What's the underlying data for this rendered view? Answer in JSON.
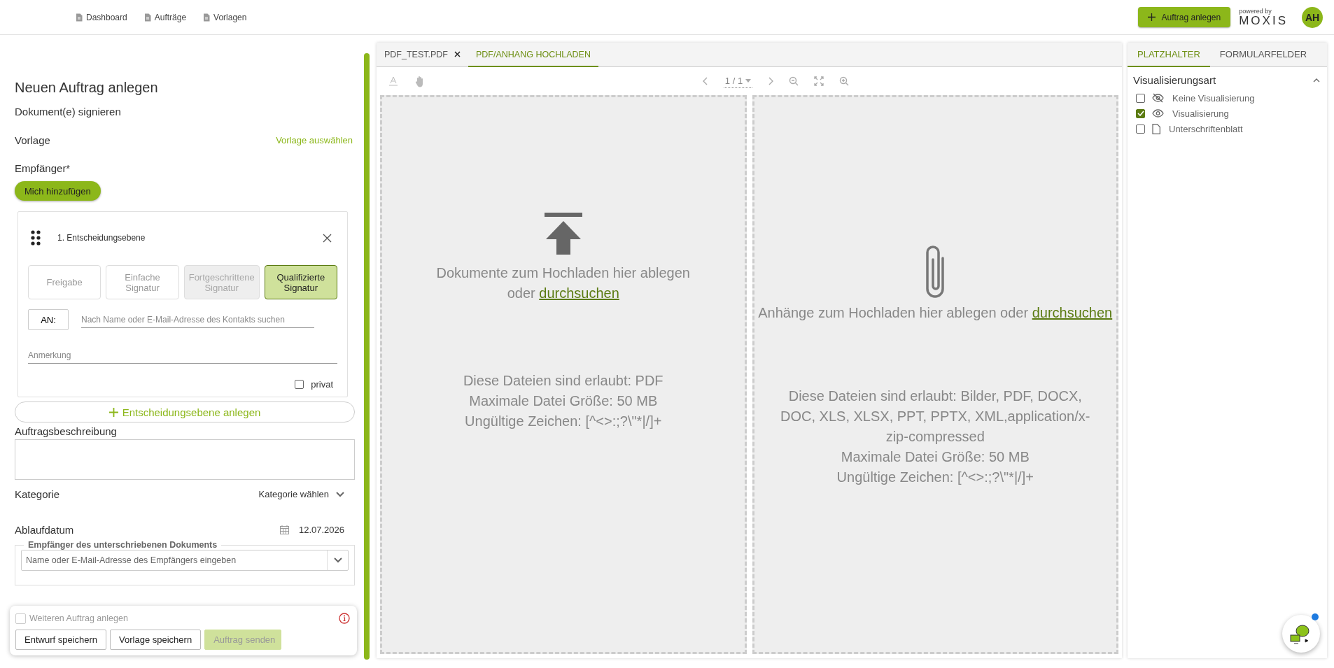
{
  "nav": {
    "items": [
      {
        "label": "Dashboard"
      },
      {
        "label": "Aufträge"
      },
      {
        "label": "Vorlagen"
      }
    ],
    "create_button": "Auftrag anlegen",
    "powered_by": "powered by",
    "brand": "MOXIS",
    "avatar": "AH"
  },
  "form": {
    "title": "Neuen Auftrag anlegen",
    "subtitle": "Dokument(e) signieren",
    "template_label": "Vorlage",
    "template_link": "Vorlage auswählen",
    "recipients_label": "Empfänger*",
    "add_me_button": "Mich hinzufügen",
    "level": {
      "title": "1. Entscheidungsebene",
      "signature_types": [
        {
          "label": "Freigabe",
          "selected": false,
          "disabled": false
        },
        {
          "label": "Einfache Signatur",
          "selected": false,
          "disabled": false
        },
        {
          "label": "Fortgeschrittene Signatur",
          "selected": false,
          "disabled": true
        },
        {
          "label": "Qualifizierte Signatur",
          "selected": true,
          "disabled": false
        }
      ],
      "to_label": "AN:",
      "contact_placeholder": "Nach Name oder E-Mail-Adresse des Kontakts suchen",
      "note_placeholder": "Anmerkung",
      "private": {
        "label": "privat",
        "checked": false
      }
    },
    "add_level_button": "Entscheidungsebene anlegen",
    "description_label": "Auftragsbeschreibung",
    "category_label": "Kategorie",
    "category_select": "Kategorie wählen",
    "expiry_label": "Ablaufdatum",
    "expiry_value": "12.07.2026",
    "signed_recipients": {
      "legend": "Empfänger des unterschriebenen Dokuments",
      "placeholder": "Name oder E-Mail-Adresse des Empfängers eingeben"
    }
  },
  "footer": {
    "another_order": {
      "label": "Weiteren Auftrag anlegen",
      "checked": false
    },
    "buttons": [
      {
        "label": "Entwurf speichern",
        "disabled": false
      },
      {
        "label": "Vorlage speichern",
        "disabled": false
      },
      {
        "label": "Auftrag senden",
        "disabled": true
      }
    ]
  },
  "viewer": {
    "tabs": [
      {
        "label": "PDF_TEST.PDF",
        "selected": false,
        "closable": true
      },
      {
        "label": "PDF/ANHANG HOCHLADEN",
        "selected": true,
        "closable": false
      }
    ],
    "page": "1 / 1",
    "dropzones": [
      {
        "kind": "document",
        "text": "Dokumente zum Hochladen hier ablegen oder",
        "link": "durchsuchen",
        "info": [
          "Diese Dateien sind erlaubt: PDF",
          "Maximale Datei Größe: 50 MB",
          "Ungültige Zeichen: [^<>:;?\\\"*|/]+"
        ]
      },
      {
        "kind": "attachment",
        "text": "Anhänge zum Hochladen hier ablegen oder",
        "link": "durchsuchen",
        "info": [
          "Diese Dateien sind erlaubt: Bilder, PDF, DOCX, DOC, XLS, XLSX, PPT, PPTX, XML,application/x-zip-compressed",
          "Maximale Datei Größe: 50 MB",
          "Ungültige Zeichen: [^<>:;?\\\"*|/]+"
        ]
      }
    ]
  },
  "side": {
    "tabs": [
      {
        "label": "PLATZHALTER",
        "selected": true
      },
      {
        "label": "FORMULARFELDER",
        "selected": false
      }
    ],
    "section": "Visualisierungsart",
    "options": [
      {
        "kind": "hidden",
        "label": "Keine Visualisierung",
        "checked": false
      },
      {
        "kind": "visible",
        "label": "Visualisierung",
        "checked": true
      },
      {
        "kind": "sheet",
        "label": "Unterschriftenblatt",
        "checked": false
      }
    ]
  }
}
